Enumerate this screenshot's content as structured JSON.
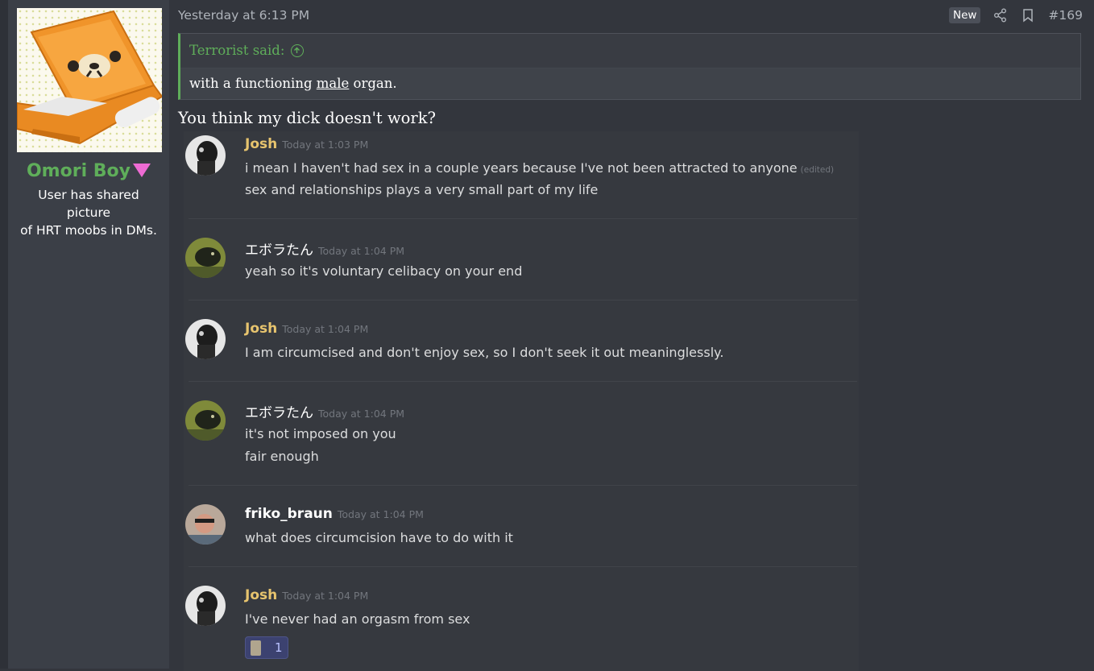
{
  "post": {
    "timestamp": "Yesterday at 6:13 PM",
    "badge": "New",
    "post_number": "#169",
    "share_icon": "share-icon",
    "bookmark_icon": "bookmark-icon"
  },
  "user": {
    "name": "Omori Boy",
    "title_line1": "User has shared picture",
    "title_line2": "of HRT moobs in DMs."
  },
  "quote": {
    "author_said": "Terrorist said:",
    "text_before": "with a functioning ",
    "text_link": "male",
    "text_after": " organ."
  },
  "reply": "You think my dick doesn't work?",
  "discord": {
    "messages": [
      {
        "author": "Josh",
        "time": "Today at 1:03 PM",
        "lines": [
          "i mean I haven't had sex in a couple years because I've not been attracted to anyone",
          "sex and relationships plays a very small part of my life"
        ],
        "edited": "(edited)"
      },
      {
        "author": "エボラたん",
        "time": "Today at 1:04 PM",
        "lines": [
          "yeah so it's voluntary celibacy on your end"
        ]
      },
      {
        "author": "Josh",
        "time": "Today at 1:04 PM",
        "lines": [
          "I am circumcised and don't enjoy sex, so I don't seek it out meaninglessly."
        ]
      },
      {
        "author": "エボラたん",
        "time": "Today at 1:04 PM",
        "lines": [
          "it's not imposed on you",
          "fair enough"
        ]
      },
      {
        "author": "friko_braun",
        "time": "Today at 1:04 PM",
        "lines": [
          "what does circumcision have to do with it"
        ]
      },
      {
        "author": "Josh",
        "time": "Today at 1:04 PM",
        "lines": [
          "I've never had an orgasm from sex"
        ]
      }
    ],
    "reaction_count": "1"
  },
  "colors": {
    "username": "#5fae5a",
    "josh": "#e7c46e",
    "quote_border": "#5fae5a",
    "heart_triangle": "#ee6bd4"
  }
}
